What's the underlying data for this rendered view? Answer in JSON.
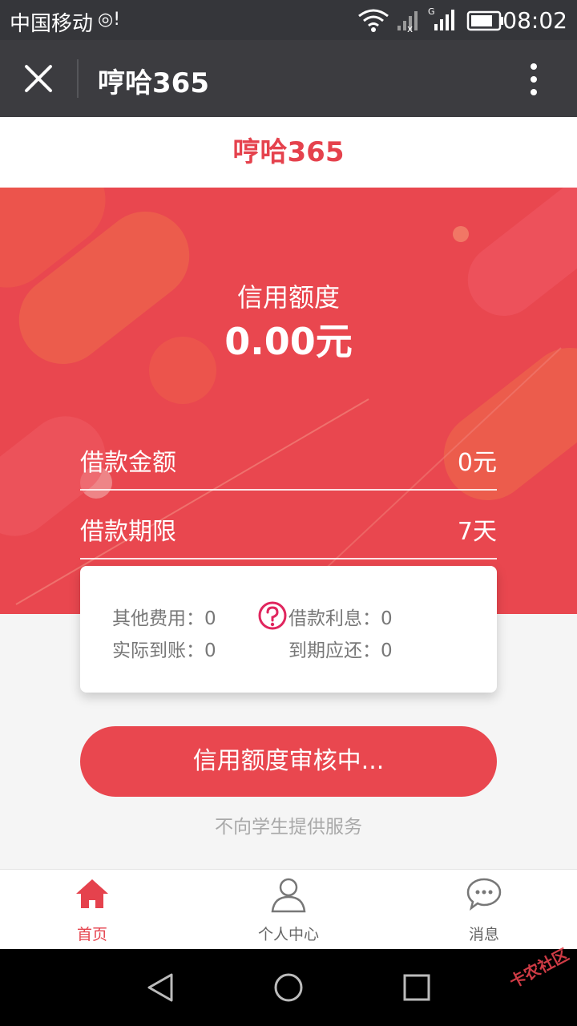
{
  "status_bar": {
    "carrier": "中国移动",
    "time": "08:02"
  },
  "titlebar": {
    "title": "哼哈365"
  },
  "page": {
    "brand": "哼哈365"
  },
  "credit": {
    "label": "信用额度",
    "value": "0.00元"
  },
  "loan": {
    "amount_label": "借款金额",
    "amount_value": "0元",
    "term_label": "借款期限",
    "term_value": "7天"
  },
  "fees": {
    "other_fees": "其他费用：0",
    "actual_received": "实际到账：0",
    "interest": "借款利息：0",
    "due_repay": "到期应还：0"
  },
  "cta_label": "信用额度审核中...",
  "notice": "不向学生提供服务",
  "tabs": [
    {
      "label": "首页",
      "icon": "home-icon",
      "active": true
    },
    {
      "label": "个人中心",
      "icon": "person-icon",
      "active": false
    },
    {
      "label": "消息",
      "icon": "message-icon",
      "active": false
    }
  ],
  "watermark": "卡农社区",
  "colors": {
    "accent": "#e9474f",
    "titlebar": "#3c3c40",
    "statusbar": "#35363a"
  }
}
